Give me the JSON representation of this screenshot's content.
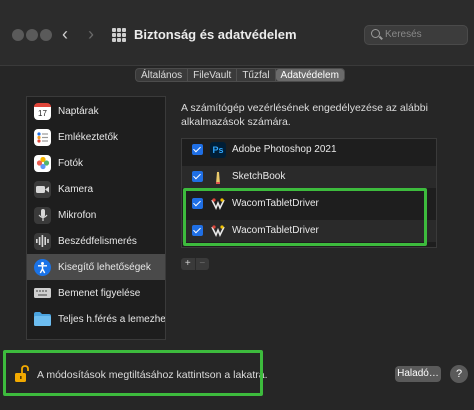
{
  "window": {
    "title": "Biztonság és adatvédelem",
    "search_placeholder": "Keresés",
    "back_glyph": "‹",
    "forward_glyph": "›"
  },
  "tabs": [
    {
      "label": "Általános",
      "active": false
    },
    {
      "label": "FileVault",
      "active": false
    },
    {
      "label": "Tűzfal",
      "active": false
    },
    {
      "label": "Adatvédelem",
      "active": true
    }
  ],
  "sidebar": {
    "items": [
      {
        "label": "Naptárak",
        "icon": "calendar-icon",
        "icon_text": "17",
        "color": "#ffffff",
        "selected": false
      },
      {
        "label": "Emlékeztetők",
        "icon": "reminders-icon",
        "icon_text": "",
        "color": "#ffffff",
        "selected": false
      },
      {
        "label": "Fotók",
        "icon": "photos-icon",
        "icon_text": "✿",
        "color": "#ffffff",
        "selected": false
      },
      {
        "label": "Kamera",
        "icon": "camera-icon",
        "icon_text": "■",
        "color": "#3a3a3a",
        "selected": false
      },
      {
        "label": "Mikrofon",
        "icon": "microphone-icon",
        "icon_text": "🎙",
        "color": "#3a3a3a",
        "selected": false
      },
      {
        "label": "Beszédfelismerés",
        "icon": "speech-recognition-icon",
        "icon_text": "|||",
        "color": "#3a3a3a",
        "selected": false
      },
      {
        "label": "Kisegítő lehetőségek",
        "icon": "accessibility-icon",
        "icon_text": "♿",
        "color": "#1a73e8",
        "selected": true
      },
      {
        "label": "Bemenet figyelése",
        "icon": "keyboard-icon",
        "icon_text": "",
        "color": "#bdbdbd",
        "selected": false
      },
      {
        "label": "Teljes h.férés a lemezhez",
        "icon": "folder-icon",
        "icon_text": "",
        "color": "#4aa3df",
        "selected": false
      }
    ]
  },
  "main": {
    "description": "A számítógép vezérlésének engedélyezése az alábbi alkalmazások számára.",
    "apps": [
      {
        "label": "Adobe Photoshop 2021",
        "icon": "photoshop-icon",
        "icon_text": "Ps",
        "checked": true
      },
      {
        "label": "SketchBook",
        "icon": "sketchbook-icon",
        "icon_text": "",
        "checked": true
      },
      {
        "label": "WacomTabletDriver",
        "icon": "wacom-icon",
        "icon_text": "",
        "checked": true
      },
      {
        "label": "WacomTabletDriver",
        "icon": "wacom-icon",
        "icon_text": "",
        "checked": true
      }
    ],
    "add_glyph": "+",
    "remove_glyph": "−"
  },
  "footer": {
    "lock_text": "A módosítások megtiltásához kattintson a lakatra.",
    "advanced_label": "Haladó…",
    "help_glyph": "?"
  },
  "colors": {
    "accent": "#1f6fe5",
    "highlight": "#3dbb3d"
  }
}
